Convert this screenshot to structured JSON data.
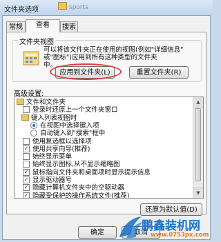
{
  "window": {
    "title": "文件夹选项",
    "background_title": "sports"
  },
  "tabs": [
    {
      "label": "常规"
    },
    {
      "label": "查看"
    },
    {
      "label": "搜索"
    }
  ],
  "folder_views": {
    "group_label": "文件夹视图",
    "description": [
      "可以将该文件夹正在使用的视图(例如\"详细信息\"",
      "或\"图标\")应用到所有这种类型的文件夹",
      "中。"
    ],
    "apply_button": "应用到文件夹(L)",
    "reset_button": "重置文件夹(R)"
  },
  "advanced": {
    "label": "高级设置:",
    "items": [
      {
        "type": "folder",
        "text": "文件和文件夹",
        "checked": false
      },
      {
        "type": "checkbox",
        "text": "登录时还原上一个文件夹窗口",
        "checked": false
      },
      {
        "type": "folder",
        "text": "键入列表视图时",
        "checked": false
      },
      {
        "type": "radio",
        "text": "在视图中选择键入项",
        "checked": true
      },
      {
        "type": "radio",
        "text": "自动键入到\"搜索\"框中",
        "checked": false
      },
      {
        "type": "checkbox",
        "text": "使用复选框以选择项",
        "checked": false
      },
      {
        "type": "checkbox",
        "text": "使用共享向导(推荐)",
        "checked": true
      },
      {
        "type": "checkbox",
        "text": "始终显示菜单",
        "checked": false
      },
      {
        "type": "checkbox",
        "text": "始终显示图标,从不显示缩略图",
        "checked": false
      },
      {
        "type": "checkbox",
        "text": "鼠标指向文件夹和桌面项时显示提示信息",
        "checked": true
      },
      {
        "type": "checkbox",
        "text": "显示驱动器号",
        "checked": true
      },
      {
        "type": "checkbox",
        "text": "隐藏计算机文件夹中的空驱动器",
        "checked": true
      },
      {
        "type": "checkbox",
        "text": "隐藏受保护的操作系统文件(推荐)",
        "checked": true
      }
    ],
    "restore_button": "还原为默认值(D)"
  },
  "footer": {
    "ok": "确定",
    "cancel": "取消"
  },
  "watermark": {
    "brand": "鹏鑫装机网",
    "url": "www.0753px.com"
  },
  "colors": {
    "highlight": "#e23b3b",
    "watermark_blue": "#1e73c8",
    "watermark_orange": "#e0831c"
  }
}
